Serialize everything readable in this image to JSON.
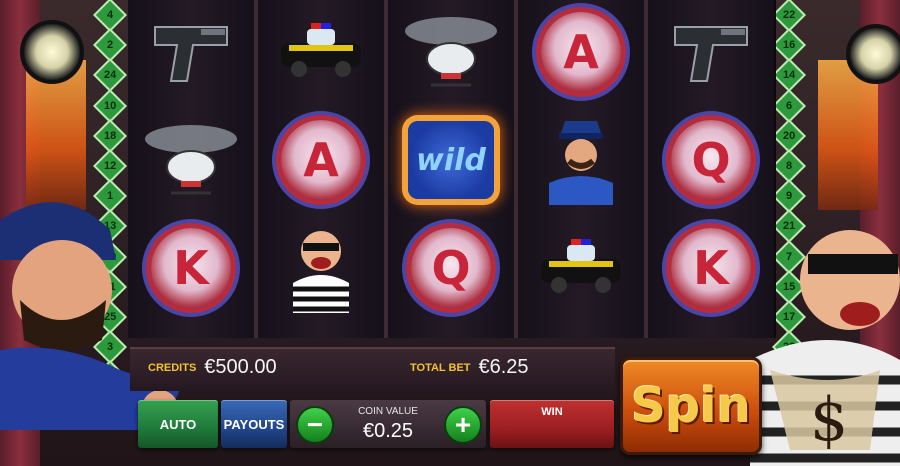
{
  "paylines_left": [
    "4",
    "2",
    "24",
    "10",
    "18",
    "12",
    "1",
    "13",
    "19",
    "11",
    "25",
    "3",
    "5"
  ],
  "paylines_right": [
    "22",
    "16",
    "14",
    "6",
    "20",
    "8",
    "9",
    "21",
    "7",
    "15",
    "17",
    "23"
  ],
  "reels": [
    {
      "symbols": [
        "pistol",
        "helicopter",
        "K"
      ]
    },
    {
      "symbols": [
        "police-car",
        "A",
        "robber"
      ]
    },
    {
      "symbols": [
        "helicopter",
        "wild",
        "Q"
      ]
    },
    {
      "symbols": [
        "A",
        "policeman",
        "police-car"
      ]
    },
    {
      "symbols": [
        "pistol",
        "Q",
        "K"
      ]
    }
  ],
  "wild_text": "wild",
  "letters": {
    "a": "A",
    "q": "Q",
    "k": "K"
  },
  "credits": {
    "label": "CREDITS",
    "value": "€500.00"
  },
  "total_bet": {
    "label": "TOTAL BET",
    "value": "€6.25"
  },
  "buttons": {
    "auto": "AUTO",
    "payouts": "PAYOUTS",
    "spin": "Spin",
    "minus": "−",
    "plus": "+"
  },
  "coin_value": {
    "label": "COIN VALUE",
    "value": "€0.25"
  },
  "win": {
    "label": "WIN"
  },
  "colors": {
    "accent": "#f1c232",
    "auto_btn": "#1f7a3a",
    "payouts_btn": "#21468a",
    "win_btn": "#9c1f22",
    "spin": "#d8681a"
  }
}
